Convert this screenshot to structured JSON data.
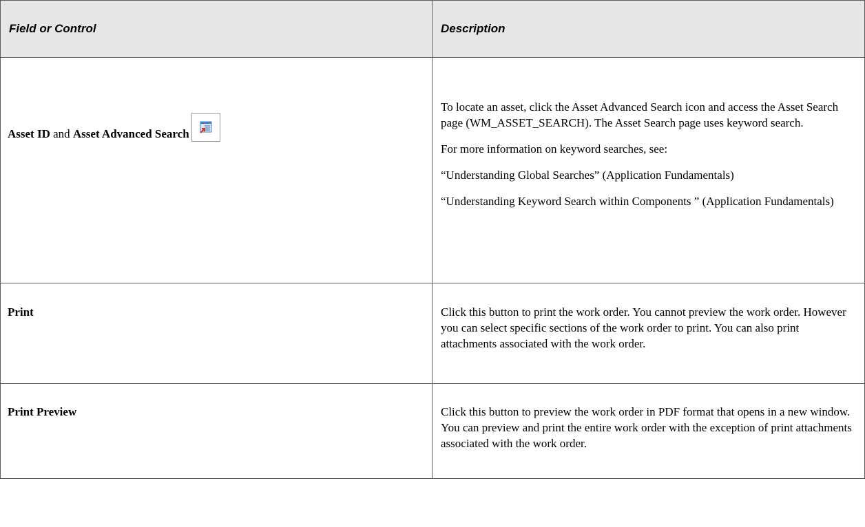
{
  "header": {
    "col1": "Field or Control",
    "col2": "Description"
  },
  "rows": [
    {
      "field_parts": [
        "Asset ID",
        " and ",
        "Asset Advanced Search"
      ],
      "icon": "asset-advanced-search-icon",
      "description": [
        "To locate an asset, click the Asset Advanced Search icon and access the Asset Search page (WM_ASSET_SEARCH). The Asset Search page uses keyword search.",
        "For more information on keyword searches, see:",
        "“Understanding Global Searches” (Application Fundamentals)",
        "“Understanding Keyword Search within Components ” (Application Fundamentals)"
      ]
    },
    {
      "field": "Print",
      "description": [
        "Click this button to print the work order. You cannot preview the work order. However you can select specific sections of the work order to print. You can also print attachments associated with the work order."
      ]
    },
    {
      "field": "Print Preview",
      "description": [
        "Click this button to preview the work order in PDF format that opens in a new window. You can preview and print the entire work order with the exception of print attachments associated with the work order."
      ]
    }
  ],
  "colors": {
    "header_bg": "#e6e6e6",
    "border": "#5c5c5c",
    "icon_blue": "#4a7fc1",
    "icon_red": "#d0372b"
  }
}
